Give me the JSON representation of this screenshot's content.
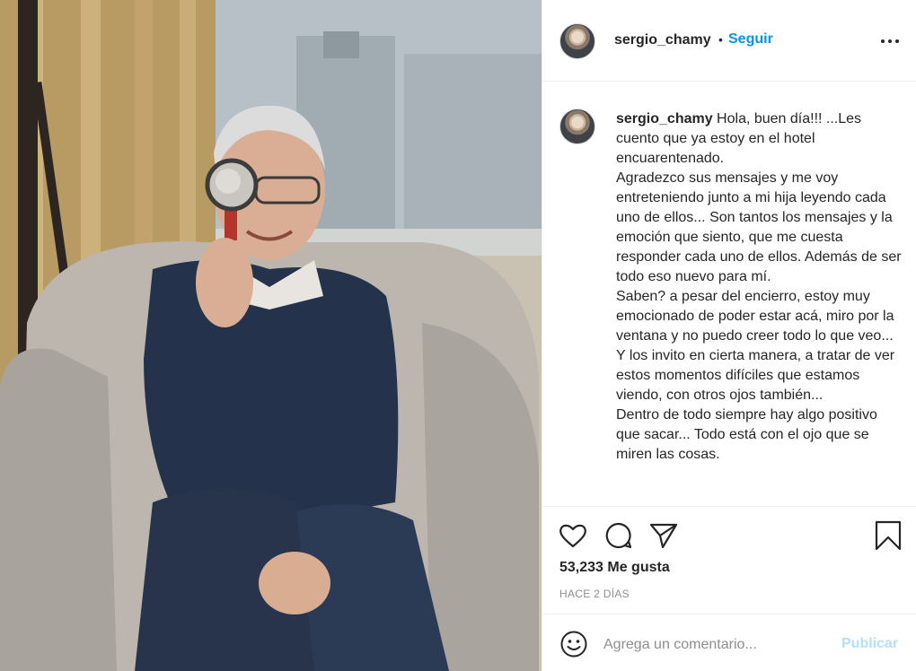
{
  "post": {
    "image_alt_description": "",
    "author": {
      "username": "sergio_chamy",
      "follow_label": "Seguir",
      "separator": "•"
    },
    "caption": {
      "username": "sergio_chamy",
      "text": " Hola, buen día!!! ...Les cuento que ya estoy en el hotel encuarentenado.\nAgradezco sus mensajes y me voy entreteniendo junto a mi hija leyendo cada uno de ellos... Son tantos los mensajes y la emoción que siento, que me cuesta responder cada uno de ellos. Además de ser todo eso nuevo para mí.\nSaben? a pesar del encierro, estoy muy emocionado de poder estar acá, miro por la ventana y no puedo creer todo lo que veo... Y los invito en cierta manera, a tratar de ver estos momentos difíciles que estamos viendo, con otros ojos también...\nDentro de todo siempre hay algo positivo que sacar... Todo está con el ojo que se miren las cosas."
    },
    "actions": {
      "icons": [
        "heart-icon",
        "comment-icon",
        "share-icon",
        "bookmark-icon"
      ]
    },
    "likes_text": "53,233 Me gusta",
    "time_text": "HACE 2 DÍAS",
    "comment": {
      "placeholder": "Agrega un comentario...",
      "value": "",
      "publish_label": "Publicar"
    },
    "colors": {
      "accent": "#0095f6",
      "publish_disabled": "#b2dffc",
      "text": "#262626",
      "secondary": "#8e8e8e",
      "border": "#efefef"
    }
  }
}
